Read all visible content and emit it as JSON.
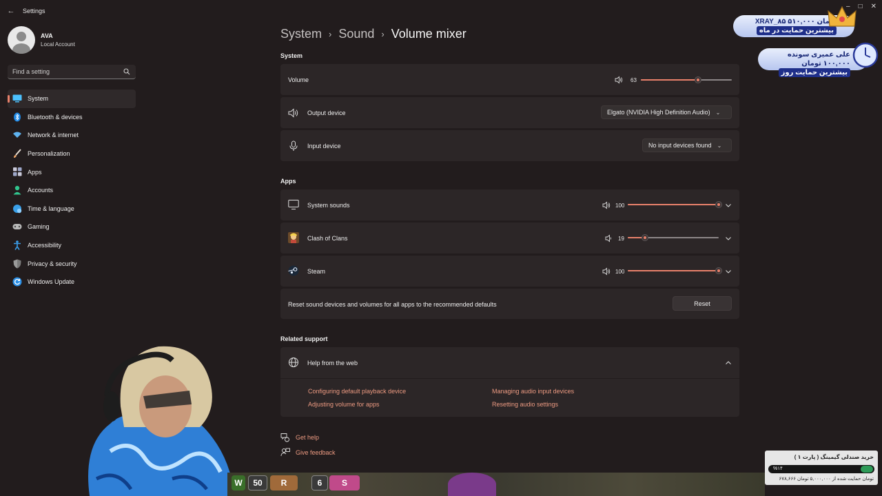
{
  "window": {
    "title": "Settings"
  },
  "profile": {
    "name": "AVA",
    "account_type": "Local Account"
  },
  "search": {
    "placeholder": "Find a setting"
  },
  "sidebar": {
    "items": [
      {
        "label": "System",
        "icon": "monitor-icon",
        "selected": true,
        "color": "#4cc2ff"
      },
      {
        "label": "Bluetooth & devices",
        "icon": "bluetooth-icon",
        "selected": false,
        "color": "#1e88e5"
      },
      {
        "label": "Network & internet",
        "icon": "wifi-icon",
        "selected": false,
        "color": "#5fb3f0"
      },
      {
        "label": "Personalization",
        "icon": "brush-icon",
        "selected": false,
        "color": "#f0a86b"
      },
      {
        "label": "Apps",
        "icon": "apps-icon",
        "selected": false,
        "color": "#b0b0c0"
      },
      {
        "label": "Accounts",
        "icon": "person-icon",
        "selected": false,
        "color": "#31c48d"
      },
      {
        "label": "Time & language",
        "icon": "globe-clock-icon",
        "selected": false,
        "color": "#3aa0e8"
      },
      {
        "label": "Gaming",
        "icon": "gamepad-icon",
        "selected": false,
        "color": "#b8b8b8"
      },
      {
        "label": "Accessibility",
        "icon": "accessibility-icon",
        "selected": false,
        "color": "#3a9ce8"
      },
      {
        "label": "Privacy & security",
        "icon": "shield-icon",
        "selected": false,
        "color": "#9a9a9a"
      },
      {
        "label": "Windows Update",
        "icon": "update-icon",
        "selected": false,
        "color": "#2b8fe6"
      }
    ]
  },
  "breadcrumb": [
    "System",
    "Sound",
    "Volume mixer"
  ],
  "system_section": {
    "title": "System",
    "volume": {
      "label": "Volume",
      "value": "63",
      "level": 0.63
    },
    "output": {
      "label": "Output device",
      "selected": "Elgato (NVIDIA High Definition Audio)"
    },
    "input": {
      "label": "Input device",
      "selected": "No input devices found"
    }
  },
  "apps_section": {
    "title": "Apps",
    "apps": [
      {
        "name": "System sounds",
        "value": "100",
        "level": 1.0,
        "icon": "monitor-icon"
      },
      {
        "name": "Clash of Clans",
        "value": "19",
        "level": 0.19,
        "icon": "clash-of-clans-icon"
      },
      {
        "name": "Steam",
        "value": "100",
        "level": 1.0,
        "icon": "steam-icon"
      }
    ],
    "reset_text": "Reset sound devices and volumes for all apps to the recommended defaults",
    "reset_button": "Reset"
  },
  "related": {
    "title": "Related support",
    "help_title": "Help from the web",
    "links": [
      "Configuring default playback device",
      "Managing audio input devices",
      "Adjusting volume for apps",
      "Resetting audio settings"
    ]
  },
  "footer": {
    "get_help": "Get help",
    "give_feedback": "Give feedback"
  },
  "overlay": {
    "donation_top": {
      "line1": "XRAY_۸۵  ۵۱۰,۰۰۰ تومان",
      "line2": "بیشترین حمایت در ماه"
    },
    "donation_bottom": {
      "line1": "علی عمیری سونده  ۱۰۰,۰۰۰ تومان",
      "line2": "بیشترین حمایت روز"
    },
    "goal": {
      "title": "خرید صندلی گیمینگ ( پارت ۱ )",
      "percent": "%۱۴",
      "progress": 0.14,
      "footer": "۶۷۸,۶۶۶ تومان حمایت شده از ۵,۰۰۰,۰۰۰ تومان"
    },
    "game_badges": [
      "W",
      "50",
      "R",
      "6",
      "S"
    ]
  }
}
